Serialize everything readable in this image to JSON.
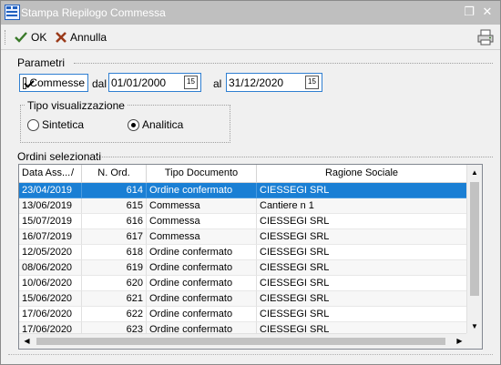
{
  "window": {
    "title": "Stampa Riepilogo Commessa",
    "title_buttons": {
      "restore": "❐",
      "close": "✕"
    }
  },
  "toolbar": {
    "ok_label": "OK",
    "cancel_label": "Annulla",
    "print_icon": "printer-icon"
  },
  "parametri": {
    "label": "Parametri",
    "commesse_label": "Commesse",
    "commesse_checked": true,
    "dal_label": "dal",
    "dal_value": "01/01/2000",
    "al_label": "al",
    "al_value": "31/12/2020",
    "calendar_icon_text": "15"
  },
  "tipo_visualizzazione": {
    "label": "Tipo visualizzazione",
    "options": [
      {
        "label": "Sintetica",
        "selected": false
      },
      {
        "label": "Analitica",
        "selected": true
      }
    ]
  },
  "ordini": {
    "label": "Ordini selezionati",
    "columns": [
      "Data Ass...",
      "N. Ord.",
      "Tipo Documento",
      "Ragione Sociale"
    ],
    "sort_indicator": "/",
    "rows": [
      {
        "data": "23/04/2019",
        "n_ord": "614",
        "tipo": "Ordine confermato",
        "ragione": "CIESSEGI SRL",
        "selected": true
      },
      {
        "data": "13/06/2019",
        "n_ord": "615",
        "tipo": "Commessa",
        "ragione": "Cantiere n 1",
        "selected": false
      },
      {
        "data": "15/07/2019",
        "n_ord": "616",
        "tipo": "Commessa",
        "ragione": "CIESSEGI SRL",
        "selected": false
      },
      {
        "data": "16/07/2019",
        "n_ord": "617",
        "tipo": "Commessa",
        "ragione": "CIESSEGI SRL",
        "selected": false
      },
      {
        "data": "12/05/2020",
        "n_ord": "618",
        "tipo": "Ordine confermato",
        "ragione": "CIESSEGI SRL",
        "selected": false
      },
      {
        "data": "08/06/2020",
        "n_ord": "619",
        "tipo": "Ordine confermato",
        "ragione": "CIESSEGI SRL",
        "selected": false
      },
      {
        "data": "10/06/2020",
        "n_ord": "620",
        "tipo": "Ordine confermato",
        "ragione": "CIESSEGI SRL",
        "selected": false
      },
      {
        "data": "15/06/2020",
        "n_ord": "621",
        "tipo": "Ordine confermato",
        "ragione": "CIESSEGI SRL",
        "selected": false
      },
      {
        "data": "17/06/2020",
        "n_ord": "622",
        "tipo": "Ordine confermato",
        "ragione": "CIESSEGI SRL",
        "selected": false
      },
      {
        "data": "17/06/2020",
        "n_ord": "623",
        "tipo": "Ordine confermato",
        "ragione": "CIESSEGI SRL",
        "selected": false
      }
    ]
  },
  "colors": {
    "selection": "#1a7fd4",
    "focus_border": "#2f7fd1",
    "titlebar": "#bfbfbf"
  }
}
